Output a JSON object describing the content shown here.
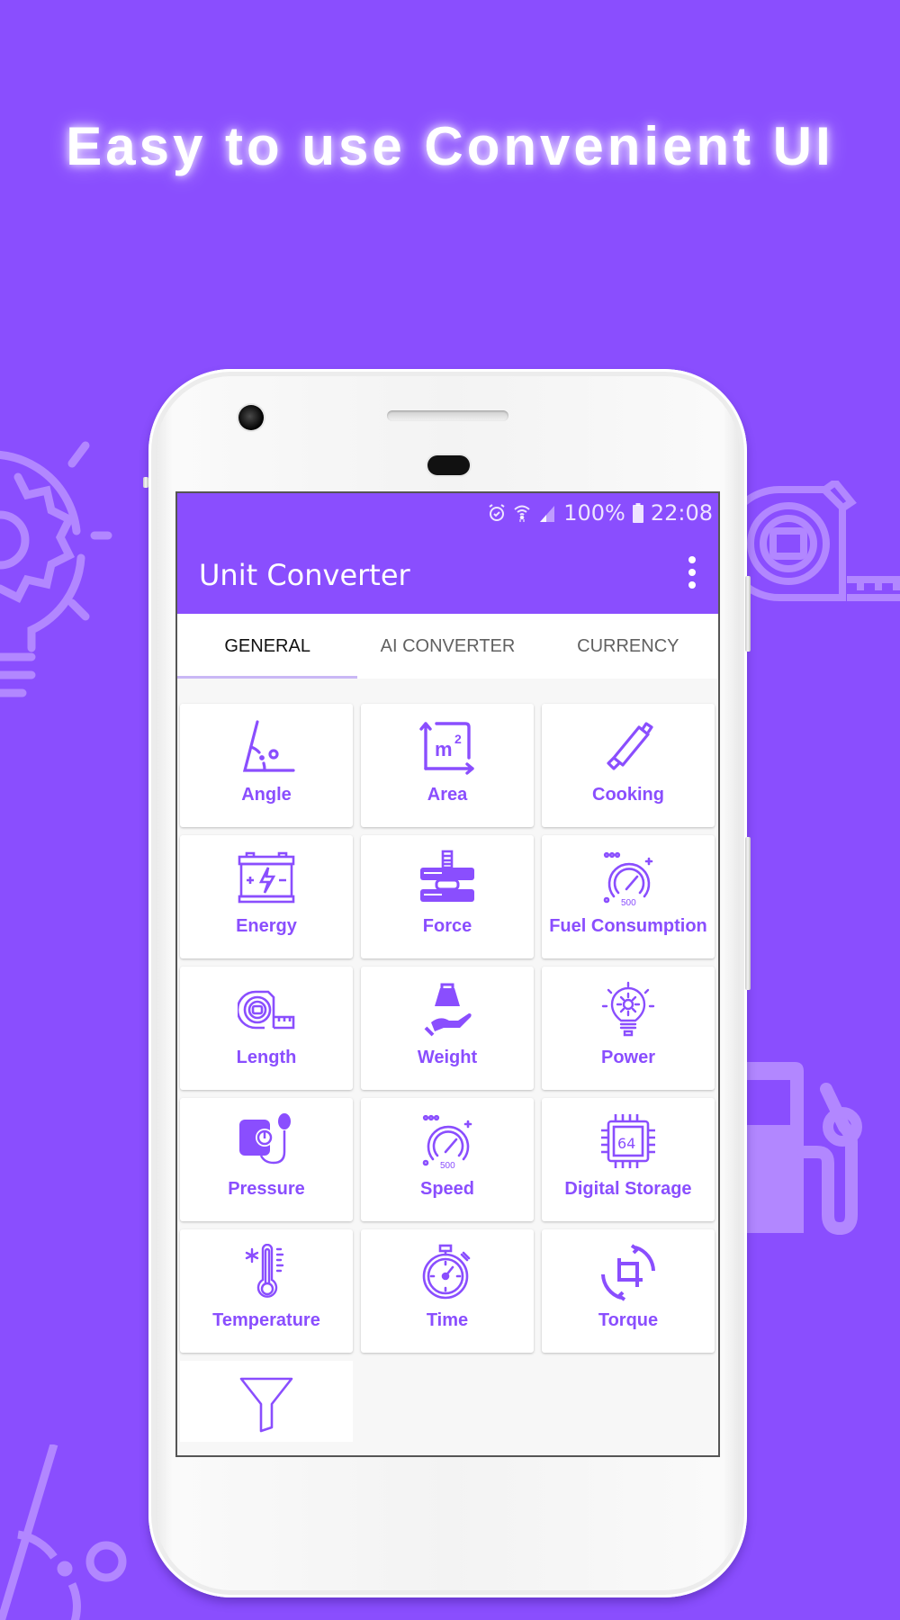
{
  "headline": "Easy to use Convenient UI",
  "colors": {
    "brand": "#8a4efe",
    "background": "#8a4efe",
    "card_label": "#8a4efe",
    "tab_indicator": "#c9b8f5"
  },
  "background_icons": [
    "lightbulb-gear-icon",
    "tape-measure-icon",
    "fuel-pump-icon",
    "angle-icon"
  ],
  "status_bar": {
    "icons": [
      "alarm-icon",
      "wifi-icon",
      "signal-icon",
      "battery-icon"
    ],
    "battery": "100%",
    "time": "22:08"
  },
  "app": {
    "title": "Unit Converter",
    "menu_icon": "more-vert-icon"
  },
  "tabs": [
    {
      "label": "GENERAL",
      "active": true
    },
    {
      "label": "AI CONVERTER",
      "active": false
    },
    {
      "label": "CURRENCY",
      "active": false
    }
  ],
  "categories": [
    {
      "label": "Angle",
      "icon": "angle-icon"
    },
    {
      "label": "Area",
      "icon": "area-m2-icon"
    },
    {
      "label": "Cooking",
      "icon": "rolling-pin-icon"
    },
    {
      "label": "Energy",
      "icon": "battery-energy-icon"
    },
    {
      "label": "Force",
      "icon": "press-force-icon"
    },
    {
      "label": "Fuel Consumption",
      "icon": "gauge-icon"
    },
    {
      "label": "Length",
      "icon": "tape-measure-icon"
    },
    {
      "label": "Weight",
      "icon": "weight-hand-icon"
    },
    {
      "label": "Power",
      "icon": "lightbulb-gear-icon"
    },
    {
      "label": "Pressure",
      "icon": "blood-pressure-icon"
    },
    {
      "label": "Speed",
      "icon": "speedometer-icon"
    },
    {
      "label": "Digital Storage",
      "icon": "chip-64-icon"
    },
    {
      "label": "Temperature",
      "icon": "thermometer-icon"
    },
    {
      "label": "Time",
      "icon": "stopwatch-icon"
    },
    {
      "label": "Torque",
      "icon": "rotate-crop-icon"
    },
    {
      "label": "",
      "icon": "funnel-icon"
    }
  ],
  "gauge_text": "500",
  "chip_text": "64"
}
